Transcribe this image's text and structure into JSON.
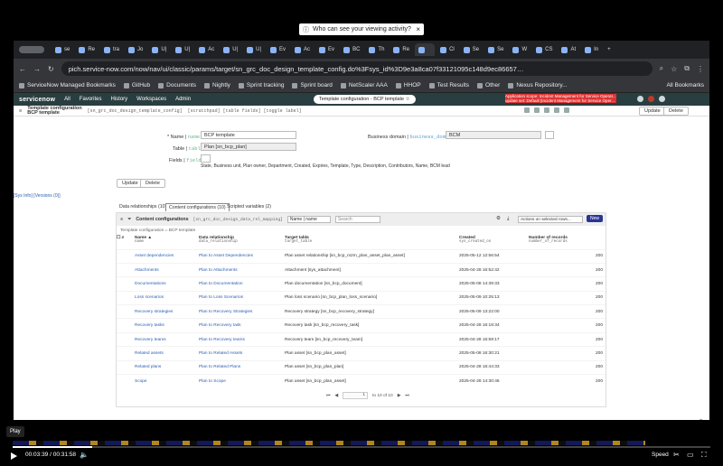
{
  "share_banner": {
    "text": "Who can see your viewing activity?",
    "close": "×"
  },
  "browser": {
    "tabs": [
      "se",
      "Re",
      "tra",
      "Jo",
      "U|",
      "U|",
      "Ac",
      "U|",
      "U|",
      "Ev",
      "Ac",
      "Ev",
      "BC",
      "Th",
      "Re",
      "",
      "Cl",
      "Se",
      "Se",
      "W",
      "CS",
      "At",
      "In"
    ],
    "new_tab": "+",
    "url": "pich.service-now.com/now/nav/ui/classic/params/target/sn_grc_doc_design_template_config.do%3Fsys_id%3D9e3a8ca07f33121095c148d9ec86657…",
    "bookmarks": [
      "ServiceNow Managed Bookmarks",
      "GitHub",
      "Documents",
      "Nightly",
      "Sprint tracking",
      "Sprint board",
      "NetScaler AAA",
      "HHOP",
      "Test Results",
      "Other",
      "Nexus Repository..."
    ],
    "all_bookmarks": "All Bookmarks"
  },
  "sn": {
    "logo": "servicenow",
    "nav": [
      "All",
      "Favorites",
      "History",
      "Workspaces",
      "Admin"
    ],
    "context_title": "Template configuration - BCP template ☆",
    "scope_line1": "Application scope: Incident Management for Service Operat...",
    "scope_line2": "update set: Default [Incident Management for Service Oper..."
  },
  "form_header": {
    "title1": "Template configuration",
    "title2": "BCP template",
    "tablename": "[sn_grc_doc_design_template_config]",
    "links": "[scratchpad] [table fields] [toggle label]",
    "update": "Update",
    "delete": "Delete"
  },
  "form": {
    "name_label": "Name",
    "name_tech": "name",
    "name_value": "BCP template",
    "table_label": "Table",
    "table_tech": "table",
    "table_value": "Plan [sn_bcp_plan]",
    "fields_label": "Fields",
    "fields_tech": "fields",
    "fields_value": "State, Business unit, Plan owner, Department, Created, Expires, Template, Type, Description, Contributors, Name, BCM lead",
    "bd_label": "Business domain",
    "bd_tech": "business_domain",
    "bd_value": "BCM",
    "side_link": "[Sys Info] [Versions (0)]",
    "update": "Update",
    "delete": "Delete"
  },
  "related": {
    "tabs": [
      "Data relationships (10)",
      "Content configurations (10)",
      "Scripted variables (2)"
    ],
    "list_title": "Content configurations",
    "list_table": "[sn_grc_doc_design_data_rel_mapping]",
    "search_field": "Name | name",
    "search_placeholder": "Search",
    "actions": "Actions on selected rows...",
    "new": "New",
    "breadcrumb": "Template configuration = BCP template",
    "columns": [
      {
        "label": "Name ▲",
        "tech": "name"
      },
      {
        "label": "Data relationship",
        "tech": "data_relationship"
      },
      {
        "label": "Target table",
        "tech": "target_table"
      },
      {
        "label": "Created",
        "tech": "sys_created_on"
      },
      {
        "label": "Number of records",
        "tech": "number_of_records"
      }
    ],
    "rows": [
      [
        "Asset dependencies",
        "Plan to Asset Dependencies",
        "Plan asset relationship [sn_bcp_m2m_plan_asset_plan_asset]",
        "2025-05-12 12:56:54",
        "200"
      ],
      [
        "Attachments",
        "Plan to Attachments",
        "Attachment [sys_attachment]",
        "2025-04-28 16:52:42",
        "200"
      ],
      [
        "Documentations",
        "Plan to Documentation",
        "Plan documentation [sn_bcp_document]",
        "2025-05-08 14:39:33",
        "200"
      ],
      [
        "Loss scenarios",
        "Plan to Loss Scenarios",
        "Plan loss scenario [sn_bcp_plan_loss_scenario]",
        "2025-05-09 10:25:13",
        "200"
      ],
      [
        "Recovery strategies",
        "Plan to Recovery Strategies",
        "Recovery strategy [sn_bcp_recovery_strategy]",
        "2025-05-09 13:22:00",
        "200"
      ],
      [
        "Recovery tasks",
        "Plan to Recovery task",
        "Recovery task [sn_bcp_recovery_task]",
        "2025-04-28 16:18:34",
        "200"
      ],
      [
        "Recovery teams",
        "Plan to Recovery teams",
        "Recovery team [sn_bcp_recovery_team]",
        "2025-04-28 16:59:17",
        "200"
      ],
      [
        "Related assets",
        "Plan to Related Assets",
        "Plan asset [sn_bcp_plan_asset]",
        "2025-05-08 16:30:21",
        "200"
      ],
      [
        "Related plans",
        "Plan to Related Plans",
        "Plan asset [sn_bcp_plan_plan]",
        "2025-04-28 16:44:33",
        "200"
      ],
      [
        "Scope",
        "Plan to Scope",
        "Plan asset [sn_bcp_plan_asset]",
        "2025-04-28 14:30:46",
        "200"
      ]
    ],
    "pager": {
      "first": "⏮",
      "prev": "◀",
      "page": "1",
      "of": "to 10 of 10",
      "next": "▶",
      "last": "⏭"
    }
  },
  "player": {
    "tooltip": "Play",
    "time": "00:03:39 / 00:31:58",
    "speed": "Speed",
    "progress_fraction": 0.114
  }
}
